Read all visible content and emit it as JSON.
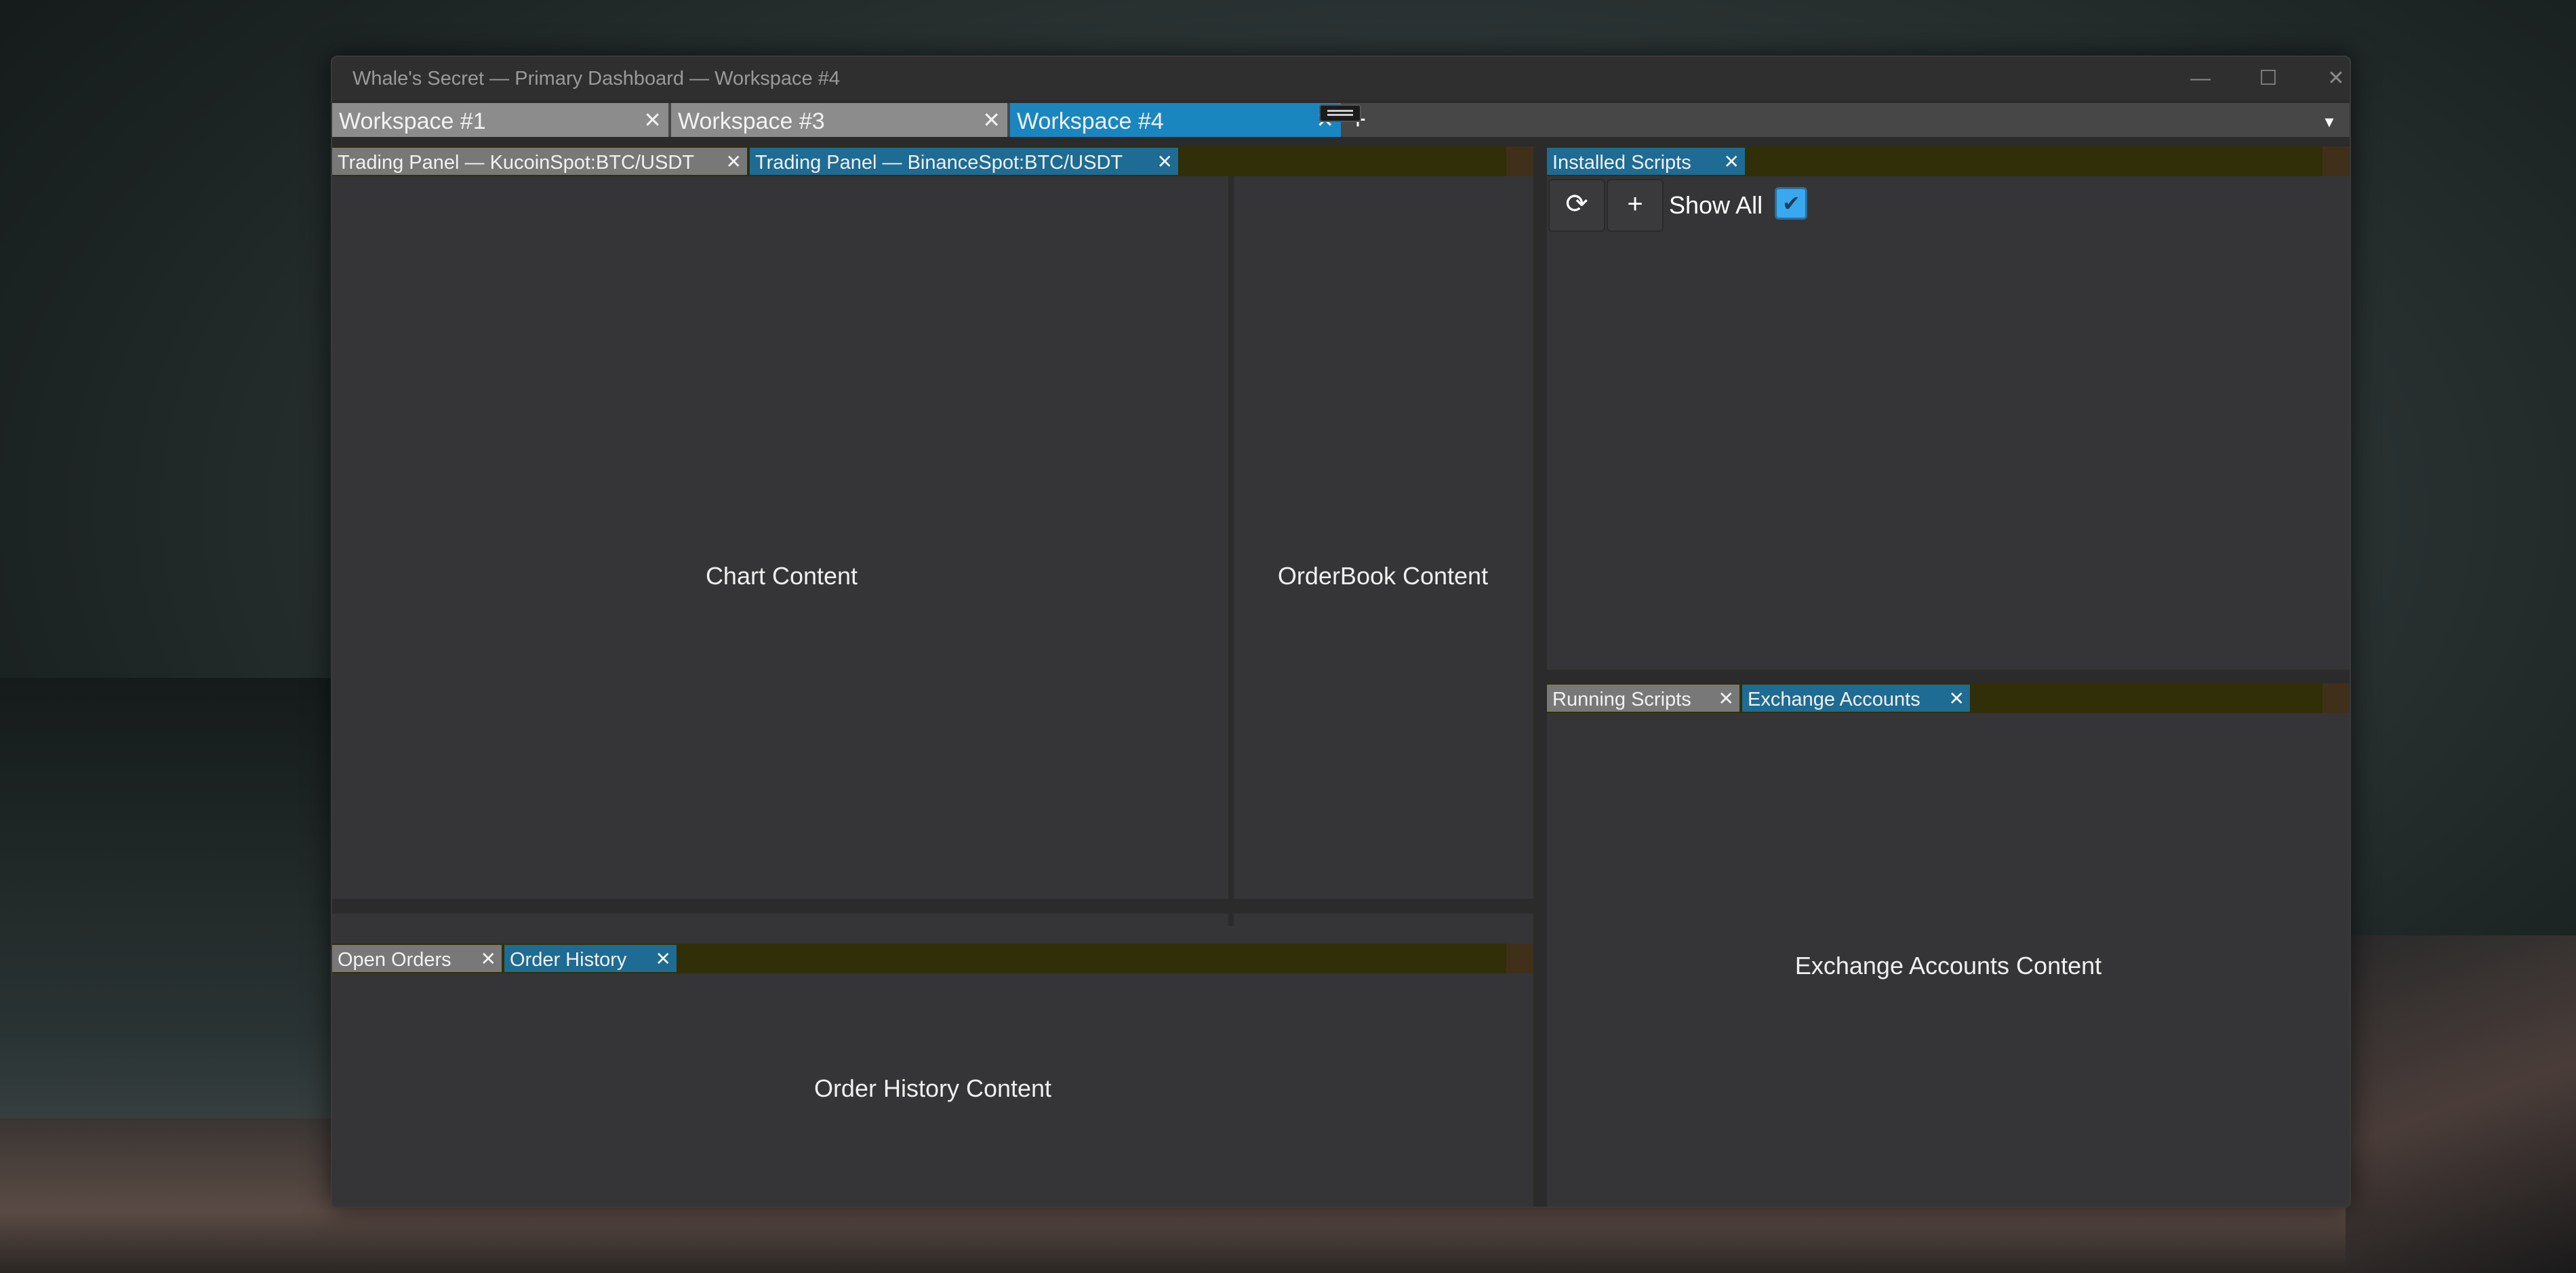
{
  "window": {
    "title": "Whale's Secret — Primary Dashboard — Workspace #4",
    "controls": {
      "minimize": "—",
      "maximize": "☐",
      "close": "✕"
    }
  },
  "workspace_tabs": [
    {
      "label": "Workspace #1",
      "close": "✕",
      "active": false
    },
    {
      "label": "Workspace #3",
      "close": "✕",
      "active": false
    },
    {
      "label": "Workspace #4",
      "close": "✕",
      "active": true
    }
  ],
  "workspace_add": "+",
  "workspace_menu": "▾",
  "panels": {
    "trading": {
      "tabs": [
        {
          "label": "Trading Panel — KucoinSpot:BTC/USDT",
          "close": "✕",
          "active": false
        },
        {
          "label": "Trading Panel — BinanceSpot:BTC/USDT",
          "close": "✕",
          "active": true
        }
      ],
      "chart_content": "Chart Content",
      "orderbook_content": "OrderBook Content"
    },
    "orders": {
      "tabs": [
        {
          "label": "Open Orders",
          "close": "✕",
          "active": false
        },
        {
          "label": "Order History",
          "close": "✕",
          "active": true
        }
      ],
      "content": "Order History Content"
    },
    "installed_scripts": {
      "tabs": [
        {
          "label": "Installed Scripts",
          "close": "✕",
          "active": true
        }
      ],
      "refresh_icon": "⟳",
      "add_icon": "+",
      "show_all_label": "Show All",
      "show_all_checked": true,
      "check_icon": "✔"
    },
    "accounts": {
      "tabs": [
        {
          "label": "Running Scripts",
          "close": "✕",
          "active": false
        },
        {
          "label": "Exchange Accounts",
          "close": "✕",
          "active": true
        }
      ],
      "content": "Exchange Accounts Content"
    }
  },
  "colors": {
    "active_workspace_tab": "#1a86c0",
    "inactive_workspace_tab": "#8c8c8c",
    "active_panel_tab": "#1e6b93",
    "panel_tabbar": "#302f08",
    "panel_bg": "#353537",
    "checkbox": "#3aa8ee"
  }
}
